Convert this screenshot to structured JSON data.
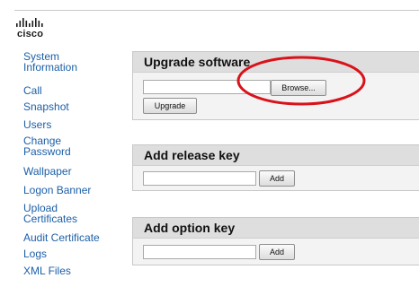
{
  "brand": {
    "logo_text": "cisco"
  },
  "sidebar": {
    "items": [
      {
        "label": "System Information",
        "line1": "System",
        "line2": "Information"
      },
      {
        "label": "Call"
      },
      {
        "label": "Snapshot"
      },
      {
        "label": "Users"
      },
      {
        "label": "Change Password",
        "line1": "Change",
        "line2": "Password"
      },
      {
        "label": "Wallpaper"
      },
      {
        "label": "Logon Banner"
      },
      {
        "label": "Upload Certificates",
        "line1": "Upload",
        "line2": "Certificates"
      },
      {
        "label": "Audit Certificate"
      },
      {
        "label": "Logs"
      },
      {
        "label": "XML Files"
      }
    ]
  },
  "upgrade_software": {
    "title": "Upgrade software",
    "file_value": "",
    "browse_label": "Browse...",
    "upgrade_label": "Upgrade"
  },
  "release_key": {
    "title": "Add release key",
    "input_value": "",
    "add_label": "Add"
  },
  "option_key": {
    "title": "Add option key",
    "input_value": "",
    "add_label": "Add"
  },
  "colors": {
    "link": "#1c5fa8",
    "section_header": "#dedede",
    "annotation": "#d9121a"
  }
}
